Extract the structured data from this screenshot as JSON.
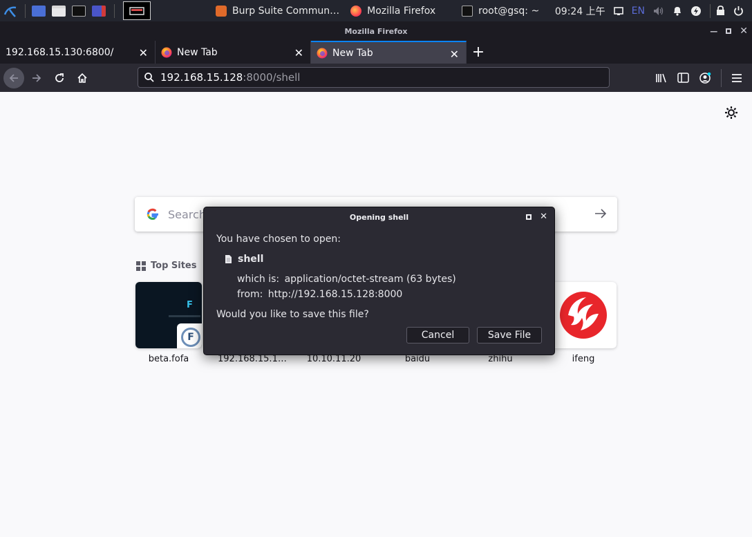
{
  "taskbar": {
    "tasks": [
      {
        "label": "Burp Suite Commun…"
      },
      {
        "label": "Mozilla Firefox"
      },
      {
        "label": "root@gsq: ~"
      }
    ],
    "clock": "09:24 上午",
    "lang": "EN"
  },
  "window": {
    "title": "Mozilla Firefox"
  },
  "tabs": [
    {
      "label": "192.168.15.130:6800/"
    },
    {
      "label": "New Tab"
    },
    {
      "label": "New Tab"
    }
  ],
  "urlbar": {
    "host": "192.168.15.128",
    "path": ":8000/shell"
  },
  "newtab": {
    "search_placeholder": "Search",
    "top_sites_title": "Top Sites",
    "sites": [
      {
        "label": "beta.fofa"
      },
      {
        "label": "192.168.15.1…"
      },
      {
        "label": "10.10.11.20"
      },
      {
        "label": "baidu"
      },
      {
        "label": "zhihu"
      },
      {
        "label": "ifeng"
      }
    ]
  },
  "dialog": {
    "title": "Opening shell",
    "intro": "You have chosen to open:",
    "filename": "shell",
    "which_is_label": "which is:",
    "which_is_value": "application/octet-stream (63 bytes)",
    "from_label": "from:",
    "from_value": "http://192.168.15.128:8000",
    "question": "Would you like to save this file?",
    "cancel_label": "Cancel",
    "save_label": "Save File"
  }
}
